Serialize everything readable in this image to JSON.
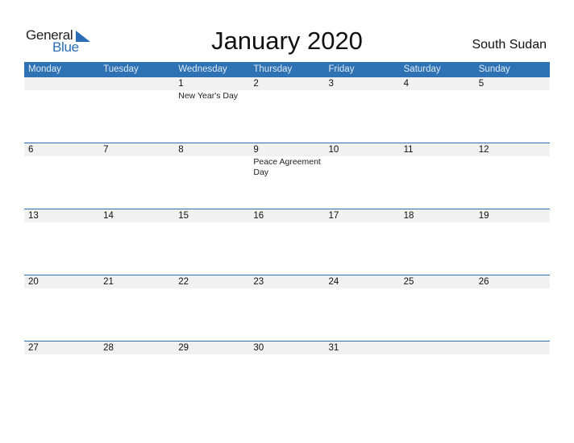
{
  "logo": {
    "line1": "General",
    "line2": "Blue"
  },
  "header": {
    "title": "January 2020",
    "country": "South Sudan"
  },
  "weekdays": [
    "Monday",
    "Tuesday",
    "Wednesday",
    "Thursday",
    "Friday",
    "Saturday",
    "Sunday"
  ],
  "weeks": [
    {
      "days": [
        "",
        "",
        "1",
        "2",
        "3",
        "4",
        "5"
      ],
      "events": [
        "",
        "",
        "New Year's Day",
        "",
        "",
        "",
        ""
      ]
    },
    {
      "days": [
        "6",
        "7",
        "8",
        "9",
        "10",
        "11",
        "12"
      ],
      "events": [
        "",
        "",
        "",
        "Peace Agreement Day",
        "",
        "",
        ""
      ]
    },
    {
      "days": [
        "13",
        "14",
        "15",
        "16",
        "17",
        "18",
        "19"
      ],
      "events": [
        "",
        "",
        "",
        "",
        "",
        "",
        ""
      ]
    },
    {
      "days": [
        "20",
        "21",
        "22",
        "23",
        "24",
        "25",
        "26"
      ],
      "events": [
        "",
        "",
        "",
        "",
        "",
        "",
        ""
      ]
    },
    {
      "days": [
        "27",
        "28",
        "29",
        "30",
        "31",
        "",
        ""
      ],
      "events": [
        "",
        "",
        "",
        "",
        "",
        "",
        ""
      ]
    }
  ],
  "colors": {
    "accent": "#2e72b4",
    "day_bar": "#f1f1f1"
  }
}
